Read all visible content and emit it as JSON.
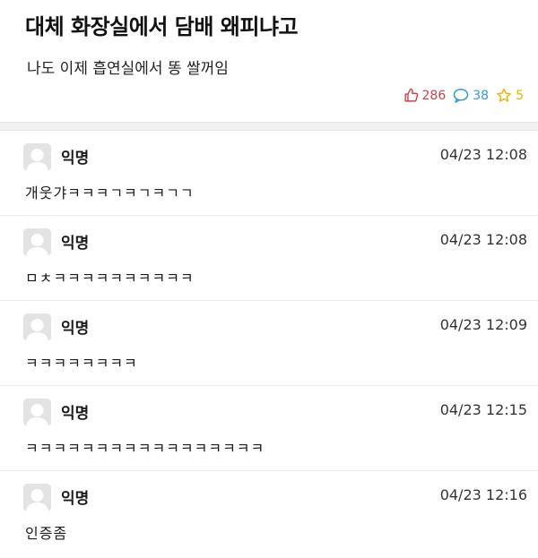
{
  "post": {
    "title": "대체 화장실에서 담배 왜피냐고",
    "body": "나도 이제 흡연실에서 똥 쌀꺼임",
    "stats": {
      "likes": "286",
      "comments": "38",
      "scraps": "5"
    },
    "icons": {
      "like": "thumbs-up-icon",
      "comment": "speech-bubble-icon",
      "scrap": "star-icon"
    },
    "colors": {
      "like": "#c8434b",
      "comment": "#2f9ad8",
      "scrap": "#e8b400"
    }
  },
  "comments": [
    {
      "author": "익명",
      "time": "04/23 12:08",
      "text": "개웃갸ㅋㅋㅋㄱㅋㄱㅋㄱㄱ"
    },
    {
      "author": "익명",
      "time": "04/23 12:08",
      "text": "ㅁㅊㅋㅋㅋㅋㅋㅋㅋㅋㅋㅋ"
    },
    {
      "author": "익명",
      "time": "04/23 12:09",
      "text": "ㅋㅋㅋㅋㅋㅋㅋㅋ"
    },
    {
      "author": "익명",
      "time": "04/23 12:15",
      "text": "ㅋㅋㅋㅋㅋㅋㅋㅋㅋㅋㅋㅋㅋㅋㅋㅋㅋ"
    },
    {
      "author": "익명",
      "time": "04/23 12:16",
      "text": "인증좀"
    }
  ]
}
